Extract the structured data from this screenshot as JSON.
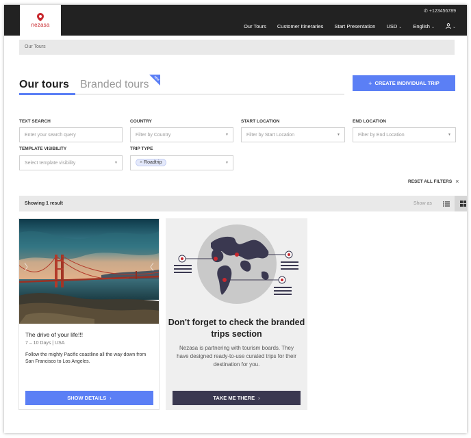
{
  "header": {
    "logo_text": "nezasa",
    "phone": "+123456789",
    "nav": {
      "our_tours": "Our Tours",
      "customer_itineraries": "Customer Itineraries",
      "start_presentation": "Start Presentation",
      "currency": "USD",
      "language": "English"
    }
  },
  "breadcrumb": "Our Tours",
  "tabs": {
    "active": "Our tours",
    "branded": "Branded tours",
    "ribbon": "NEW"
  },
  "create_button": "CREATE INDIVIDUAL TRIP",
  "filters": {
    "text_search": {
      "label": "TEXT SEARCH",
      "placeholder": "Enter your search query"
    },
    "country": {
      "label": "COUNTRY",
      "placeholder": "Filter by Country"
    },
    "start_location": {
      "label": "START LOCATION",
      "placeholder": "Filter by Start Location"
    },
    "end_location": {
      "label": "END LOCATION",
      "placeholder": "Filter by End Location"
    },
    "template_visibility": {
      "label": "TEMPLATE VISIBILITY",
      "placeholder": "Select template visibility"
    },
    "trip_type": {
      "label": "TRIP TYPE",
      "chip": "Roadtrip"
    },
    "reset": "RESET ALL FILTERS"
  },
  "results": {
    "count": "Showing 1 result",
    "show_as": "Show as"
  },
  "tour_card": {
    "title": "The drive of your life!!!",
    "meta": "7 – 10 Days | USA",
    "description": "Follow the mighty Pacific coastline all the way down from San Francisco to Los Angeles.",
    "button": "SHOW DETAILS"
  },
  "promo_card": {
    "heading": "Don't forget to check the branded trips section",
    "text": "Nezasa is partnering with tourism boards. They have designed ready-to-use curated trips for their destination for you.",
    "button": "TAKE ME THERE"
  },
  "colors": {
    "accent": "#5b7ff5",
    "header_bg": "#222222",
    "brand_red": "#c8282e",
    "dark_button": "#3a3850"
  }
}
